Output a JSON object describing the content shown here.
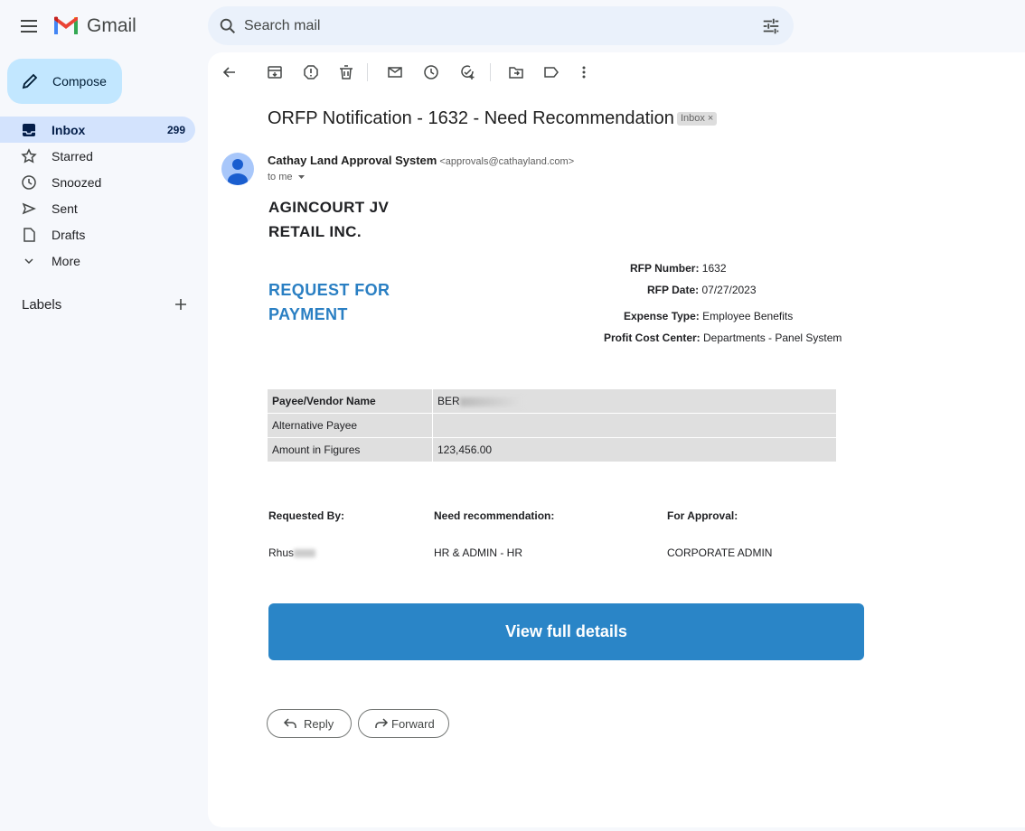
{
  "app": {
    "name": "Gmail"
  },
  "search": {
    "placeholder": "Search mail"
  },
  "sidebar": {
    "compose_label": "Compose",
    "items": [
      {
        "label": "Inbox",
        "count": "299",
        "icon": "inbox-icon"
      },
      {
        "label": "Starred",
        "icon": "star-icon"
      },
      {
        "label": "Snoozed",
        "icon": "clock-icon"
      },
      {
        "label": "Sent",
        "icon": "send-icon"
      },
      {
        "label": "Drafts",
        "icon": "draft-icon"
      },
      {
        "label": "More",
        "icon": "chevron-down-icon"
      }
    ],
    "labels_heading": "Labels"
  },
  "email": {
    "subject": "ORFP Notification - 1632 - Need Recommendation",
    "chip": "Inbox",
    "chip_close": "×",
    "sender_name": "Cathay Land Approval System",
    "sender_email": "<approvals@cathayland.com>",
    "to": "to me",
    "company_line1": "AGINCOURT JV",
    "company_line2": "RETAIL INC.",
    "title_line1": "REQUEST FOR",
    "title_line2": "PAYMENT",
    "meta": {
      "rfp_number_label": "RFP Number:",
      "rfp_number": "1632",
      "rfp_date_label": "RFP Date:",
      "rfp_date": "07/27/2023",
      "expense_type_label": "Expense Type:",
      "expense_type": "Employee Benefits",
      "profit_center_label": "Profit Cost Center:",
      "profit_center": "Departments - Panel System"
    },
    "table": {
      "payee_label": "Payee/Vendor Name",
      "payee_value": "BER",
      "alt_payee_label": "Alternative Payee",
      "alt_payee_value": "",
      "amount_label": "Amount in Figures",
      "amount_value": "123,456.00"
    },
    "signatories": {
      "requested_by_label": "Requested By:",
      "requested_by": "Rhus",
      "recommendation_label": "Need recommendation:",
      "recommendation": "HR & ADMIN - HR",
      "approval_label": "For Approval:",
      "approval": "CORPORATE ADMIN"
    },
    "cta_label": "View full details",
    "reply_label": "Reply",
    "forward_label": "Forward"
  },
  "colors": {
    "accent": "#2a85c7",
    "title_blue": "#2a7fc3",
    "compose_bg": "#c2e7ff",
    "active_nav": "#d3e3fd"
  }
}
